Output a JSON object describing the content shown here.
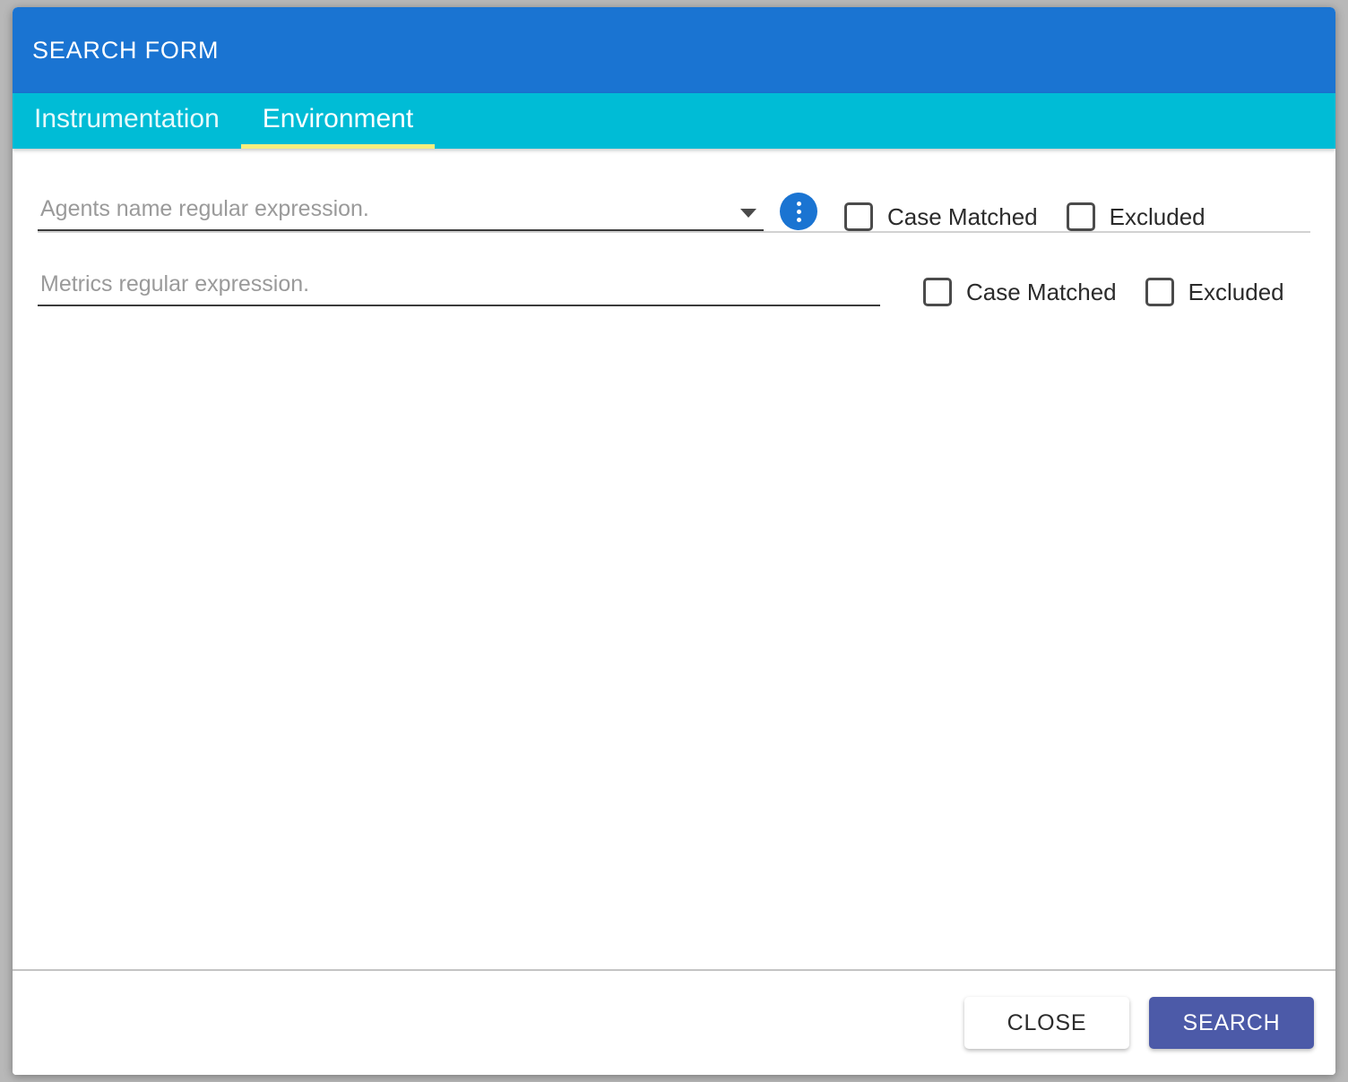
{
  "window": {
    "title": "SEARCH FORM",
    "header_color": "#1a74d2",
    "tabbar_color": "#00bcd6",
    "active_tab_underline_color": "#f5ee7e"
  },
  "tabs": [
    {
      "label": "Instrumentation",
      "active": false
    },
    {
      "label": "Environment",
      "active": true
    }
  ],
  "form": {
    "agents_row": {
      "input": {
        "placeholder": "Agents name regular expression.",
        "value": ""
      },
      "dropdown_icon": "chevron-down-icon",
      "more_button_icon": "more-vert-icon",
      "more_button_color": "#1a74d2",
      "checkboxes": [
        {
          "label": "Case Matched",
          "checked": false
        },
        {
          "label": "Excluded",
          "checked": false
        }
      ]
    },
    "metrics_row": {
      "input": {
        "placeholder": "Metrics regular expression.",
        "value": ""
      },
      "checkboxes": [
        {
          "label": "Case Matched",
          "checked": false
        },
        {
          "label": "Excluded",
          "checked": false
        }
      ]
    }
  },
  "footer": {
    "close_label": "CLOSE",
    "search_label": "SEARCH",
    "search_color": "#4c5aa8"
  }
}
